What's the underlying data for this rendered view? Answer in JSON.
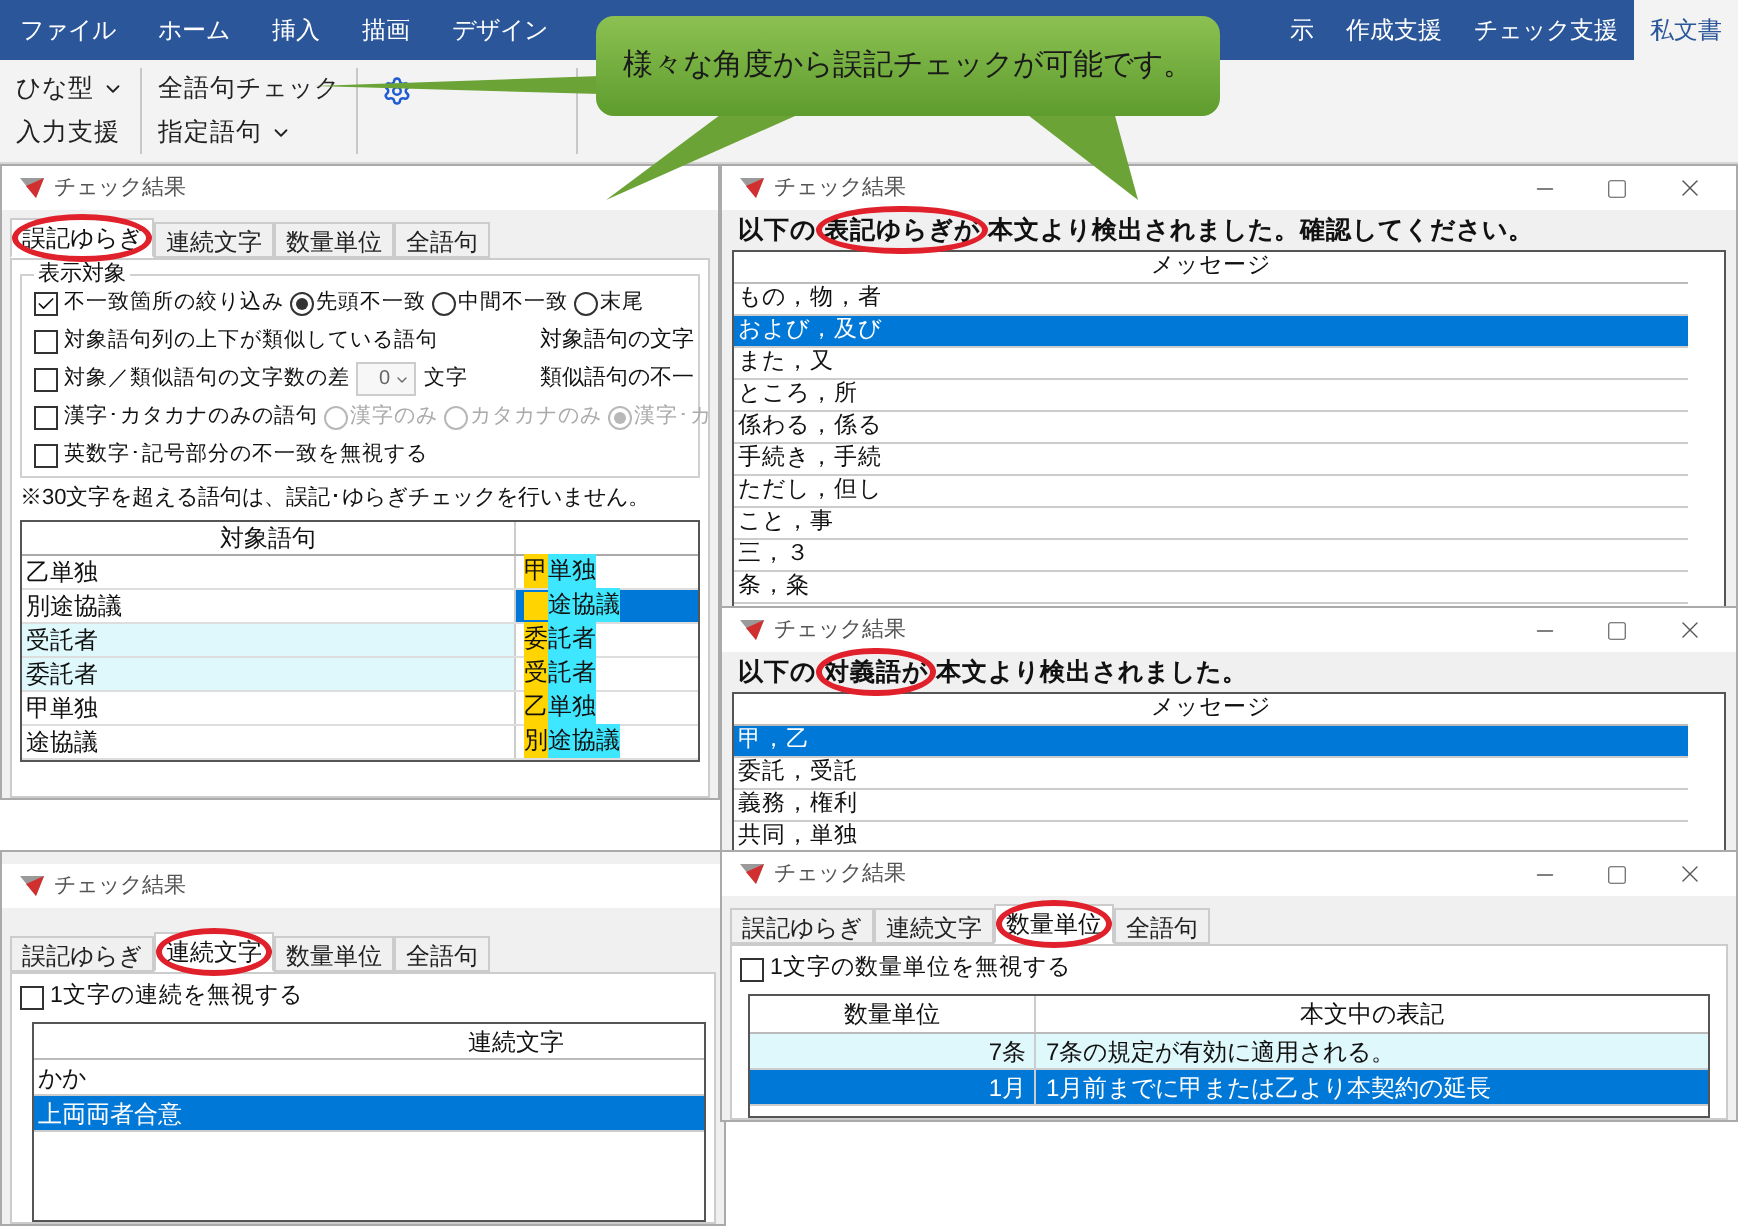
{
  "ribbon": {
    "left_tabs": [
      {
        "label": "ファイル",
        "selected": false
      },
      {
        "label": "ホーム",
        "selected": false
      },
      {
        "label": "挿入",
        "selected": false
      },
      {
        "label": "描画",
        "selected": false
      },
      {
        "label": "デザイン",
        "selected": false
      }
    ],
    "right_tabs": [
      {
        "label": "示",
        "selected": false
      },
      {
        "label": "作成支援",
        "selected": false
      },
      {
        "label": "チェック支援",
        "selected": false
      },
      {
        "label": "私文書",
        "selected": true
      }
    ],
    "groups": [
      {
        "buttons": [
          {
            "label": "ひな型",
            "dropdown": true
          },
          {
            "label": "入力支援",
            "dropdown": false
          }
        ]
      },
      {
        "buttons": [
          {
            "label": "全語句チェック",
            "dropdown": false
          },
          {
            "label": "指定語句",
            "dropdown": true
          }
        ]
      }
    ]
  },
  "callout": {
    "text": "様々な角度から誤記チェックが可能です。"
  },
  "variant_window": {
    "title": "チェック結果",
    "tabs": [
      {
        "label": "誤記ゆらぎ",
        "selected": true,
        "circled": true
      },
      {
        "label": "連続文字",
        "selected": false,
        "circled": false
      },
      {
        "label": "数量単位",
        "selected": false,
        "circled": false
      },
      {
        "label": "全語句",
        "selected": false,
        "circled": false
      }
    ],
    "group_title": "表示対象",
    "options": [
      {
        "checkbox": {
          "label": "不一致箇所の絞り込み",
          "checked": true
        },
        "radios": [
          {
            "label": "先頭不一致",
            "selected": true,
            "disabled": false
          },
          {
            "label": "中間不一致",
            "selected": false,
            "disabled": false
          },
          {
            "label": "末尾",
            "selected": false,
            "disabled": false
          }
        ]
      },
      {
        "checkbox": {
          "label": "対象語句列の上下が類似している語句",
          "checked": false
        },
        "side_label": "対象語句の文字"
      },
      {
        "checkbox": {
          "label": "対象／類似語句の文字数の差",
          "checked": false
        },
        "spinner": {
          "value": "0",
          "unit": "文字"
        },
        "side_label": "類似語句の不一"
      },
      {
        "checkbox": {
          "label": "漢字･カタカナのみの語句",
          "checked": false
        },
        "radios": [
          {
            "label": "漢字のみ",
            "selected": false,
            "disabled": true
          },
          {
            "label": "カタカナのみ",
            "selected": false,
            "disabled": true
          },
          {
            "label": "漢字･カ",
            "selected": true,
            "disabled": true
          }
        ]
      },
      {
        "checkbox": {
          "label": "英数字･記号部分の不一致を無視する",
          "checked": false
        }
      }
    ],
    "note": "※30文字を超える語句は、誤記･ゆらぎチェックを行いません。",
    "column": "対象語句",
    "rows": [
      {
        "term": "乙単独",
        "tinted": false,
        "selected": false,
        "match": [
          {
            "kind": "diff",
            "text": "甲"
          },
          {
            "kind": "same",
            "text": "単独"
          }
        ]
      },
      {
        "term": "別途協議",
        "tinted": false,
        "selected": true,
        "match": [
          {
            "kind": "blank"
          },
          {
            "kind": "same",
            "text": "途協議"
          }
        ]
      },
      {
        "term": "受託者",
        "tinted": true,
        "selected": false,
        "match": [
          {
            "kind": "diff",
            "text": "委"
          },
          {
            "kind": "same",
            "text": "託者"
          }
        ]
      },
      {
        "term": "委託者",
        "tinted": true,
        "selected": false,
        "match": [
          {
            "kind": "diff",
            "text": "受"
          },
          {
            "kind": "same",
            "text": "託者"
          }
        ]
      },
      {
        "term": "甲単独",
        "tinted": false,
        "selected": false,
        "match": [
          {
            "kind": "diff",
            "text": "乙"
          },
          {
            "kind": "same",
            "text": "単独"
          }
        ]
      },
      {
        "term": "途協議",
        "tinted": false,
        "selected": false,
        "match": [
          {
            "kind": "diff",
            "text": "別"
          },
          {
            "kind": "same",
            "text": "途協議"
          }
        ]
      }
    ]
  },
  "notation_window": {
    "title": "チェック結果",
    "message": [
      {
        "text": "以下の",
        "circled": false
      },
      {
        "text": "表記ゆらぎが",
        "circled": true
      },
      {
        "text": "本文より検出されました。確認してください。",
        "circled": false
      }
    ],
    "column": "メッセージ",
    "rows": [
      {
        "text": "もの，物，者",
        "selected": false
      },
      {
        "text": "および，及び",
        "selected": true
      },
      {
        "text": "また，又",
        "selected": false
      },
      {
        "text": "ところ，所",
        "selected": false
      },
      {
        "text": "係わる，係る",
        "selected": false
      },
      {
        "text": "手続き，手続",
        "selected": false
      },
      {
        "text": "ただし，但し",
        "selected": false
      },
      {
        "text": "こと，事",
        "selected": false
      },
      {
        "text": "三，３",
        "selected": false
      },
      {
        "text": "条，粂",
        "selected": false
      }
    ]
  },
  "antonym_window": {
    "title": "チェック結果",
    "message": [
      {
        "text": "以下の",
        "circled": false
      },
      {
        "text": "対義語が",
        "circled": true
      },
      {
        "text": "本文より検出されました。",
        "circled": false
      }
    ],
    "column": "メッセージ",
    "rows": [
      {
        "text": "甲，乙",
        "selected": true
      },
      {
        "text": "委託，受託",
        "selected": false
      },
      {
        "text": "義務，権利",
        "selected": false
      },
      {
        "text": "共同，単独",
        "selected": false
      }
    ]
  },
  "sequence_window": {
    "title": "チェック結果",
    "tabs": [
      {
        "label": "誤記ゆらぎ",
        "selected": false,
        "circled": false
      },
      {
        "label": "連続文字",
        "selected": true,
        "circled": true
      },
      {
        "label": "数量単位",
        "selected": false,
        "circled": false
      },
      {
        "label": "全語句",
        "selected": false,
        "circled": false
      }
    ],
    "checkbox": {
      "label": "1文字の連続を無視する",
      "checked": false
    },
    "column": "連続文字",
    "rows": [
      {
        "text": "かか",
        "selected": false
      },
      {
        "text": "上両両者合意",
        "selected": true
      }
    ]
  },
  "unit_window": {
    "title": "チェック結果",
    "tabs": [
      {
        "label": "誤記ゆらぎ",
        "selected": false,
        "circled": false
      },
      {
        "label": "連続文字",
        "selected": false,
        "circled": false
      },
      {
        "label": "数量単位",
        "selected": true,
        "circled": true
      },
      {
        "label": "全語句",
        "selected": false,
        "circled": false
      }
    ],
    "checkbox": {
      "label": "1文字の数量単位を無視する",
      "checked": false
    },
    "columns": [
      "数量単位",
      "本文中の表記"
    ],
    "rows": [
      {
        "cells": [
          "7条",
          "7条の規定が有効に適用される。"
        ],
        "tinted": true,
        "selected": false
      },
      {
        "cells": [
          "1月",
          "1月前までに甲または乙より本契約の延長"
        ],
        "tinted": false,
        "selected": true
      }
    ]
  }
}
